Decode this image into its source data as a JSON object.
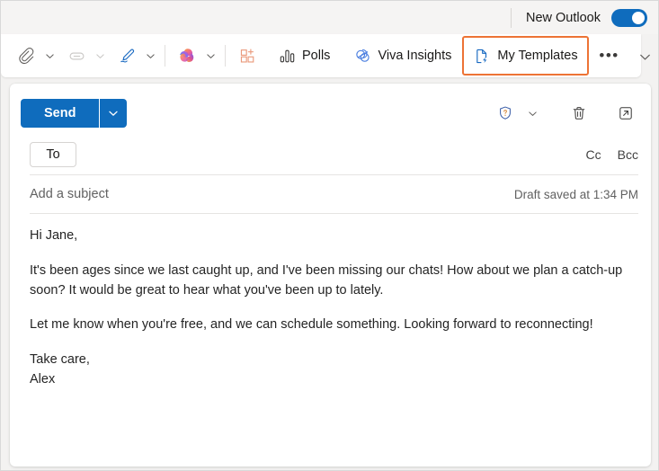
{
  "topbar": {
    "new_outlook_label": "New Outlook",
    "toggle_state": "on",
    "toggle_color": "#0f6cbd"
  },
  "toolbar": {
    "items": [
      {
        "id": "attach",
        "icon": "paperclip-icon",
        "label": "",
        "has_caret": true,
        "disabled": false
      },
      {
        "id": "link",
        "icon": "link-icon",
        "label": "",
        "has_caret": true,
        "disabled": true
      },
      {
        "id": "signature",
        "icon": "signature-pen-icon",
        "label": "",
        "has_caret": true,
        "disabled": false
      },
      {
        "id": "copilot",
        "icon": "copilot-icon",
        "label": "",
        "has_caret": true,
        "disabled": false
      },
      {
        "id": "apps",
        "icon": "apps-grid-icon",
        "label": "",
        "has_caret": false,
        "disabled": false
      },
      {
        "id": "polls",
        "icon": "polls-bar-icon",
        "label": "Polls",
        "has_caret": false,
        "disabled": false
      },
      {
        "id": "viva-insights",
        "icon": "viva-insights-icon",
        "label": "Viva Insights",
        "has_caret": false,
        "disabled": false
      },
      {
        "id": "my-templates",
        "icon": "my-templates-icon",
        "label": "My Templates",
        "has_caret": false,
        "disabled": false,
        "highlighted": true
      }
    ],
    "overflow_label": "•••",
    "highlight_color": "#ed7335"
  },
  "compose": {
    "send_label": "Send",
    "send_color": "#0f6cbd",
    "actions": [
      {
        "id": "sensitivity",
        "icon": "shield-question-icon"
      },
      {
        "id": "sensitivity-caret",
        "icon": "chevron-down-icon"
      },
      {
        "id": "discard",
        "icon": "trash-icon"
      },
      {
        "id": "popout",
        "icon": "pop-out-icon"
      }
    ],
    "to_label": "To",
    "to_value": "",
    "cc_label": "Cc",
    "bcc_label": "Bcc",
    "subject_placeholder": "Add a subject",
    "subject_value": "",
    "draft_status": "Draft saved at 1:34 PM",
    "body": {
      "greeting": "Hi Jane,",
      "paragraph_1": "It's been ages since we last caught up, and I've been missing our chats! How about we plan a catch-up soon? It would be great to hear what you've been up to lately.",
      "paragraph_2": "Let me know when you're free, and we can schedule something. Looking forward to reconnecting!",
      "closing": "Take care,",
      "signature": "Alex"
    }
  }
}
